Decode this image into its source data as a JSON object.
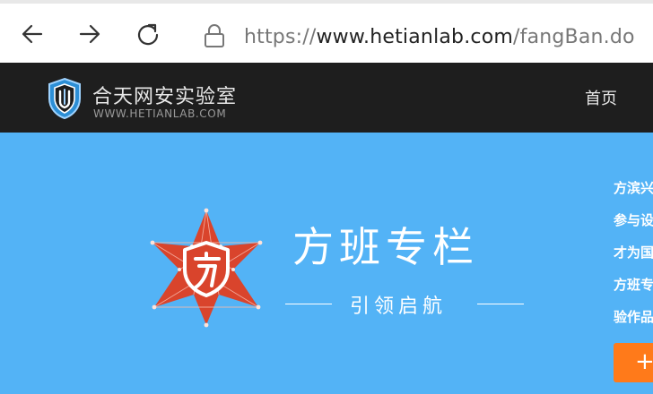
{
  "browser": {
    "url_scheme": "https://",
    "url_host": "www.hetianlab.com",
    "url_path": "/fangBan.do"
  },
  "site": {
    "name": "合天网安实验室",
    "domain_label": "WWW.HETIANLAB.COM",
    "nav_home": "首页"
  },
  "banner": {
    "title": "方班专栏",
    "subtitle": "引领启航",
    "side_links": [
      "方滨兴",
      "参与设",
      "才为国",
      "方班专",
      "验作品"
    ],
    "side_button": "+"
  },
  "colors": {
    "banner_bg": "#53b3f6",
    "header_bg": "#1e1e1e",
    "accent_orange": "#ff7a1a",
    "emblem_red": "#d9442c"
  }
}
